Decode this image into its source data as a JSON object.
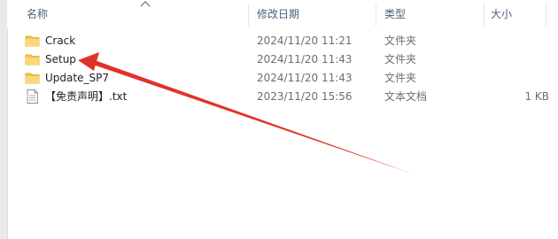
{
  "columns": {
    "name": "名称",
    "date": "修改日期",
    "type": "类型",
    "size": "大小"
  },
  "rows": [
    {
      "name": "Crack",
      "date": "2024/11/20 11:21",
      "type": "文件夹",
      "size": "",
      "icon": "folder-icon"
    },
    {
      "name": "Setup",
      "date": "2024/11/20 11:43",
      "type": "文件夹",
      "size": "",
      "icon": "folder-icon"
    },
    {
      "name": "Update_SP7",
      "date": "2024/11/20 11:43",
      "type": "文件夹",
      "size": "",
      "icon": "folder-icon"
    },
    {
      "name": "【免责声明】.txt",
      "date": "2023/11/20 15:56",
      "type": "文本文档",
      "size": "1 KB",
      "icon": "text-file-icon"
    }
  ],
  "colors": {
    "folder": "#f5c54a",
    "annotation_arrow": "#e0322a",
    "header_text": "#4c607a"
  },
  "sort": {
    "column": "name",
    "direction": "ascending",
    "icon": "chevron-up-icon"
  }
}
